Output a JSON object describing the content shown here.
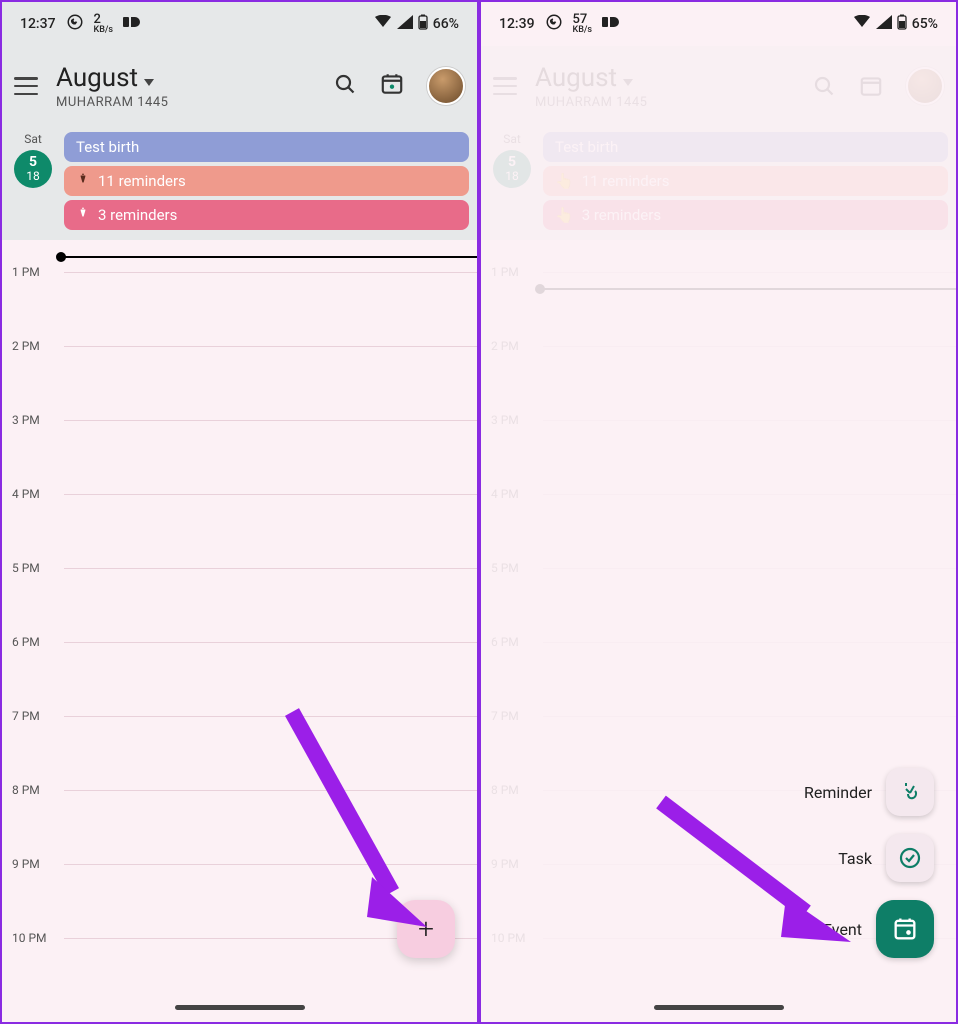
{
  "colors": {
    "accent": "#0e8a6a",
    "fab": "#f7cde0",
    "arrow": "#9b1fe8"
  },
  "left": {
    "status": {
      "time": "12:37",
      "net_num": "2",
      "net_unit": "KB/s",
      "battery": "66%"
    },
    "header": {
      "month": "August",
      "subtitle": "MUHARRAM 1445"
    },
    "day": {
      "weekday": "Sat",
      "primary": "5",
      "secondary": "18"
    },
    "allday_events": [
      {
        "label": "Test birth",
        "kind": "event"
      },
      {
        "label": "11 reminders",
        "kind": "reminder"
      },
      {
        "label": "3 reminders",
        "kind": "reminder"
      }
    ],
    "hours": [
      "1 PM",
      "2 PM",
      "3 PM",
      "4 PM",
      "5 PM",
      "6 PM",
      "7 PM",
      "8 PM",
      "9 PM",
      "10 PM"
    ]
  },
  "right": {
    "status": {
      "time": "12:39",
      "net_num": "57",
      "net_unit": "KB/s",
      "battery": "65%"
    },
    "header": {
      "month": "August",
      "subtitle": "MUHARRAM 1445"
    },
    "day": {
      "weekday": "Sat",
      "primary": "5",
      "secondary": "18"
    },
    "allday_events": [
      {
        "label": "Test birth",
        "kind": "event"
      },
      {
        "label": "11 reminders",
        "kind": "reminder"
      },
      {
        "label": "3 reminders",
        "kind": "reminder"
      }
    ],
    "hours": [
      "1 PM",
      "2 PM",
      "3 PM",
      "4 PM",
      "5 PM",
      "6 PM",
      "7 PM",
      "8 PM",
      "9 PM",
      "10 PM"
    ],
    "fab_menu": [
      {
        "label": "Reminder",
        "action": "reminder"
      },
      {
        "label": "Task",
        "action": "task"
      },
      {
        "label": "Event",
        "action": "event"
      }
    ]
  }
}
